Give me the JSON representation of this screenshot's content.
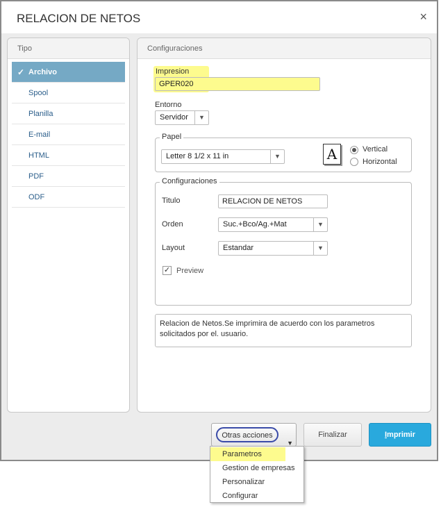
{
  "dialog": {
    "title": "RELACION DE NETOS",
    "close_label": "×"
  },
  "tipo": {
    "header": "Tipo",
    "items": [
      {
        "label": "Archivo",
        "active": true
      },
      {
        "label": "Spool"
      },
      {
        "label": "Planilla"
      },
      {
        "label": "E-mail"
      },
      {
        "label": "HTML"
      },
      {
        "label": "PDF"
      },
      {
        "label": "ODF"
      }
    ],
    "check_glyph": "✓"
  },
  "config": {
    "header": "Configuraciones",
    "impresion_label": "Impresion",
    "impresion_value": "GPER020",
    "entorno_label": "Entorno",
    "entorno_value": "Servidor",
    "papel": {
      "legend": "Papel",
      "size_value": "Letter 8 1/2 x 11 in",
      "font_glyph": "A",
      "vertical_label": "Vertical",
      "horizontal_label": "Horizontal",
      "orientation": "Vertical"
    },
    "settings": {
      "legend": "Configuraciones",
      "titulo_label": "Titulo",
      "titulo_value": "RELACION DE NETOS",
      "orden_label": "Orden",
      "orden_value": "Suc.+Bco/Ag.+Mat",
      "layout_label": "Layout",
      "layout_value": "Estandar",
      "preview_label": "Preview",
      "preview_checked": true
    },
    "description": "Relacion de Netos.Se imprimira de acuerdo con los parametros solicitados por el. usuario."
  },
  "footer": {
    "otras_label": "Otras acciones",
    "finalizar_label": "Finalizar",
    "imprimir_first": "I",
    "imprimir_rest": "mprimir"
  },
  "menu": {
    "items": [
      "Parametros",
      "Gestion de empresas",
      "Personalizar",
      "Configurar"
    ]
  },
  "colors": {
    "accent": "#29a9dd",
    "active_tab": "#75a9c5",
    "highlight": "#fdfb8e",
    "oval": "#3a4ba8"
  }
}
